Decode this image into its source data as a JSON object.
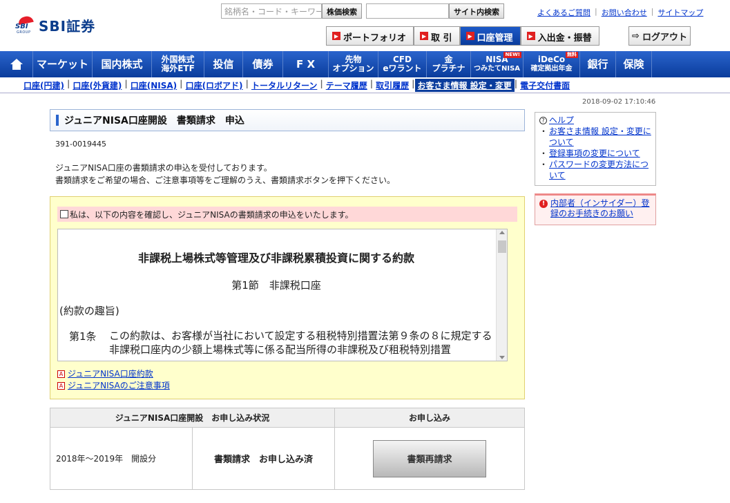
{
  "header": {
    "logo_mark": "SBI",
    "logo_group": "GROUP",
    "logo_text": "SBI証券",
    "stock_search_placeholder": "銘柄名・コード・キーワード",
    "stock_search_button": "株価検索",
    "site_search_button": "サイト内検索",
    "top_links": [
      "よくあるご質問",
      "お問い合わせ",
      "サイトマップ"
    ],
    "func_buttons": [
      {
        "label": "ポートフォリオ",
        "active": false
      },
      {
        "label": "取 引",
        "active": false
      },
      {
        "label": "口座管理",
        "active": true
      },
      {
        "label": "入出金・振替",
        "active": false
      }
    ],
    "logout_label": "ログアウト"
  },
  "mainnav": [
    {
      "label": "",
      "icon": "home-icon"
    },
    {
      "label": "マーケット"
    },
    {
      "label": "国内株式"
    },
    {
      "label": "外国株式\n海外ETF",
      "small": true
    },
    {
      "label": "投信"
    },
    {
      "label": "債券"
    },
    {
      "label": "F X"
    },
    {
      "label": "先物\nオプション",
      "small": true
    },
    {
      "label": "CFD\neワラント",
      "small": true
    },
    {
      "label": "金\nプラチナ",
      "small": true
    },
    {
      "label": "NISA\nつみたてNISA",
      "small": true,
      "badge": "NEW!"
    },
    {
      "label": "iDeCo\n確定拠出年金",
      "small": true,
      "badge": "無料"
    },
    {
      "label": "銀行"
    },
    {
      "label": "保険"
    }
  ],
  "subnav": [
    {
      "label": "口座(円建)",
      "active": false
    },
    {
      "label": "口座(外貨建)",
      "active": false
    },
    {
      "label": "口座(NISA)",
      "active": false
    },
    {
      "label": "口座(ロボアド)",
      "active": false
    },
    {
      "label": "トータルリターン",
      "active": false
    },
    {
      "label": "テーマ履歴",
      "active": false
    },
    {
      "label": "取引履歴",
      "active": false
    },
    {
      "label": "お客さま情報 設定・変更",
      "active": true
    },
    {
      "label": "電子交付書面",
      "active": false
    }
  ],
  "timestamp": "2018-09-02 17:10:46",
  "main": {
    "title": "ジュニアNISA口座開設　書類請求　申込",
    "ref_number": "391-0019445",
    "intro_line1": "ジュニアNISA口座の書類請求の申込を受付しております。",
    "intro_line2": "書類請求をご希望の場合、ご注意事項等をご理解のうえ、書類請求ボタンを押下ください。",
    "confirm_text": "私は、以下の内容を確認し、ジュニアNISAの書類請求の申込をいたします。",
    "terms": {
      "title": "非課税上場株式等管理及び非課税累積投資に関する約款",
      "section": "第1節　非課税口座",
      "purpose": "(約款の趣旨)",
      "article_num": "第1条",
      "article_body": "この約款は、お客様が当社において設定する租税特別措置法第９条の８に規定する非課税口座内の少額上場株式等に係る配当所得の非課税及び租税特別措置"
    },
    "pdf_links": [
      "ジュニアNISA口座約款",
      "ジュニアNISAのご注意事項"
    ],
    "table": {
      "header_status": "ジュニアNISA口座開設　お申し込み状況",
      "header_apply": "お申し込み",
      "period": "2018年～2019年　開設分",
      "state": "書類請求　お申し込み済",
      "button": "書類再請求"
    }
  },
  "sidebar": {
    "help_title": "ヘルプ",
    "help_items": [
      "お客さま情報 設定・変更について",
      "登録事項の変更について",
      "パスワードの変更方法について"
    ],
    "insider_link": "内部者（インサイダー）登録のお手続きのお願い"
  }
}
